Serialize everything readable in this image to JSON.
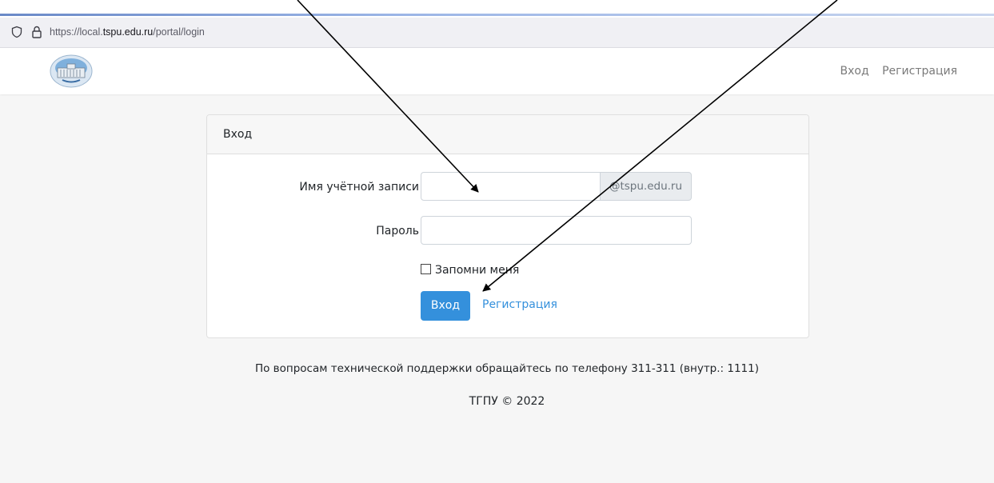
{
  "browser": {
    "url_prefix": "https://local.",
    "url_domain": "tspu.edu.ru",
    "url_path": "/portal/login"
  },
  "navbar": {
    "login_link": "Вход",
    "register_link": "Регистрация"
  },
  "card": {
    "title": "Вход",
    "username_label": "Имя учётной записи",
    "username_value": "",
    "username_suffix": "@tspu.edu.ru",
    "password_label": "Пароль",
    "password_value": "",
    "remember_label": "Запомни меня",
    "remember_checked": false,
    "submit_label": "Вход",
    "register_label": "Регистрация"
  },
  "footer": {
    "support_text": "По вопросам технической поддержки обращайтесь по телефону 311-311 (внутр.: 1111)",
    "copyright": "ТГПУ © 2022"
  },
  "colors": {
    "accent": "#3490dc",
    "background": "#f6f6f6"
  }
}
